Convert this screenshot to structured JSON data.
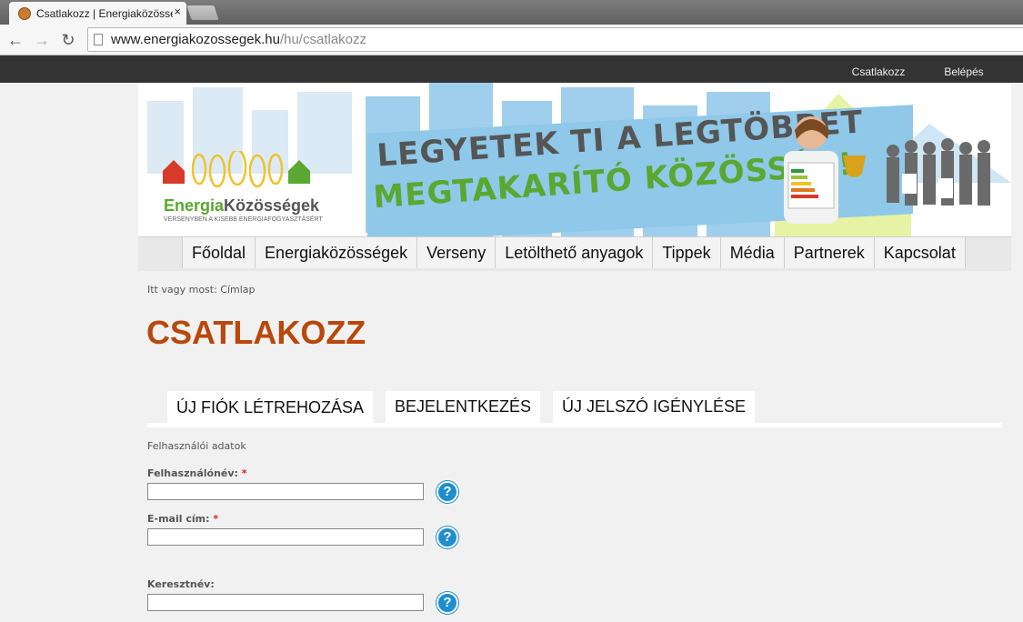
{
  "browser": {
    "tab_title": "Csatlakozz | Energiaközösségek",
    "tab_close": "×",
    "url_host": "www.energiakozossegek.hu",
    "url_path": "/hu/csatlakozz",
    "back": "←",
    "forward": "→",
    "reload": "↻"
  },
  "topbar": {
    "join_label": "Csatlakozz",
    "login_label": "Belépés"
  },
  "banner": {
    "slogan_line1": "LEGYETEK TI A LEGTÖBBET",
    "slogan_line2": "MEGTAKARÍTÓ KÖZÖSSÉG!",
    "logo_part1": "Energia",
    "logo_part2": "Közösségek",
    "logo_tagline": "VERSENYBEN A KISEBB ENERGIAFOGYASZTÁSÉRT"
  },
  "mainnav": {
    "items": [
      {
        "label": "Főoldal"
      },
      {
        "label": "Energiaközösségek"
      },
      {
        "label": "Verseny"
      },
      {
        "label": "Letölthető anyagok"
      },
      {
        "label": "Tippek"
      },
      {
        "label": "Média"
      },
      {
        "label": "Partnerek"
      },
      {
        "label": "Kapcsolat"
      }
    ]
  },
  "breadcrumb": "Itt vagy most: Címlap",
  "page_title": "CSATLAKOZZ",
  "tabs": [
    {
      "label": "ÚJ FIÓK LÉTREHOZÁSA"
    },
    {
      "label": "BEJELENTKEZÉS"
    },
    {
      "label": "ÚJ JELSZÓ IGÉNYLÉSE"
    }
  ],
  "form": {
    "section_label": "Felhasználói adatok",
    "username_label": "Felhasználónév:",
    "email_label": "E-mail cím:",
    "firstname_label": "Keresztnév:",
    "required_mark": "*",
    "username_value": "",
    "email_value": "",
    "firstname_value": "",
    "help_glyph": "?"
  },
  "colors": {
    "title": "#b8480c",
    "accent_green": "#5aa731",
    "help_blue": "#1f8ed0",
    "topbar": "#333333"
  }
}
